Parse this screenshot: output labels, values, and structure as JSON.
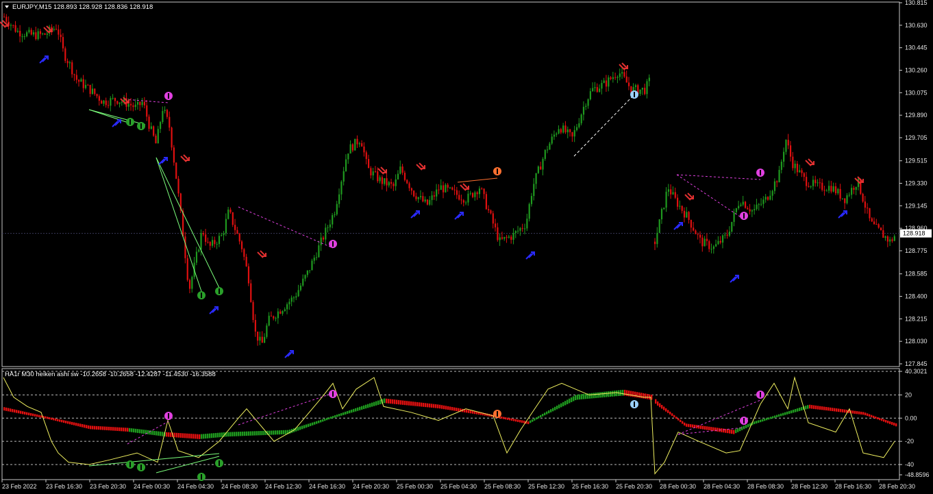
{
  "window": {
    "symbol_header": "EURJPY,M15  128.893 128.928 128.836 128.918",
    "menu_icon": "triangle-down-icon"
  },
  "price_axis": {
    "labels": [
      "130.815",
      "130.630",
      "130.445",
      "130.260",
      "130.075",
      "129.890",
      "129.705",
      "129.515",
      "129.330",
      "129.145",
      "128.960",
      "128.775",
      "128.585",
      "128.400",
      "128.215",
      "128.030",
      "127.845"
    ],
    "current_price": "128.918",
    "min": 127.845,
    "max": 130.815
  },
  "indicator": {
    "header": "HA1r M30 heiken ashi sw -10.2658 -10.2658 -12.4287 -11.4530 -16.3588",
    "axis_labels": [
      "40.3021",
      "20",
      "0.00",
      "-20",
      "-40",
      "-48.8596"
    ],
    "levels": [
      20,
      0,
      -20,
      -40
    ]
  },
  "time_axis": {
    "labels": [
      "23 Feb 2022",
      "23 Feb 16:30",
      "23 Feb 20:30",
      "24 Feb 00:30",
      "24 Feb 04:30",
      "24 Feb 08:30",
      "24 Feb 12:30",
      "24 Feb 16:30",
      "24 Feb 20:30",
      "25 Feb 00:30",
      "25 Feb 04:30",
      "25 Feb 08:30",
      "25 Feb 12:30",
      "25 Feb 16:30",
      "25 Feb 20:30",
      "28 Feb 00:30",
      "28 Feb 04:30",
      "28 Feb 08:30",
      "28 Feb 12:30",
      "28 Feb 16:30",
      "28 Feb 20:30"
    ]
  },
  "colors": {
    "background": "#000000",
    "bull": "#1f9a1f",
    "bear": "#e01010",
    "grid": "#1a1a3a",
    "axis": "#cfcfcf",
    "divergence": "#e040e0",
    "signal_up": "#2a2aff",
    "signal_down": "#e03030",
    "osc_line": "#f0f060"
  },
  "chart_data": {
    "type": "candlestick",
    "close_path": [
      [
        0,
        130.7
      ],
      [
        2,
        130.58
      ],
      [
        4,
        130.55
      ],
      [
        6,
        130.55
      ],
      [
        8,
        130.62
      ],
      [
        9,
        130.4
      ],
      [
        10,
        130.3
      ],
      [
        11,
        130.18
      ],
      [
        13,
        130.1
      ],
      [
        15,
        130.0
      ],
      [
        17,
        130.02
      ],
      [
        19,
        129.98
      ],
      [
        20,
        129.95
      ],
      [
        21,
        130.0
      ],
      [
        22,
        129.8
      ],
      [
        23,
        129.65
      ],
      [
        24,
        129.95
      ],
      [
        25,
        129.8
      ],
      [
        26,
        129.4
      ],
      [
        27,
        128.95
      ],
      [
        28,
        128.45
      ],
      [
        29,
        128.7
      ],
      [
        30,
        128.95
      ],
      [
        31,
        128.8
      ],
      [
        33,
        128.9
      ],
      [
        34,
        129.1
      ],
      [
        35,
        128.95
      ],
      [
        36,
        128.8
      ],
      [
        37,
        128.55
      ],
      [
        38,
        128.1
      ],
      [
        39,
        128.0
      ],
      [
        40,
        128.2
      ],
      [
        42,
        128.3
      ],
      [
        44,
        128.4
      ],
      [
        46,
        128.6
      ],
      [
        48,
        128.85
      ],
      [
        50,
        129.1
      ],
      [
        52,
        129.6
      ],
      [
        54,
        129.7
      ],
      [
        55,
        129.45
      ],
      [
        57,
        129.35
      ],
      [
        59,
        129.3
      ],
      [
        60,
        129.45
      ],
      [
        62,
        129.25
      ],
      [
        64,
        129.15
      ],
      [
        66,
        129.3
      ],
      [
        68,
        129.25
      ],
      [
        70,
        129.2
      ],
      [
        72,
        129.3
      ],
      [
        74,
        129.0
      ],
      [
        75,
        128.85
      ],
      [
        77,
        128.9
      ],
      [
        79,
        129.0
      ],
      [
        80,
        129.3
      ],
      [
        82,
        129.6
      ],
      [
        84,
        129.8
      ],
      [
        86,
        129.7
      ],
      [
        88,
        130.0
      ],
      [
        89,
        130.1
      ],
      [
        91,
        130.15
      ],
      [
        93,
        130.25
      ],
      [
        95,
        130.1
      ],
      [
        97,
        130.1
      ],
      [
        98,
        130.2
      ]
    ],
    "close_path_2": [
      [
        0,
        128.85
      ],
      [
        2,
        129.3
      ],
      [
        3,
        129.2
      ],
      [
        5,
        129.05
      ],
      [
        7,
        128.85
      ],
      [
        9,
        128.8
      ],
      [
        11,
        128.9
      ],
      [
        13,
        129.2
      ],
      [
        15,
        129.1
      ],
      [
        17,
        129.2
      ],
      [
        19,
        129.4
      ],
      [
        20,
        129.7
      ],
      [
        21,
        129.5
      ],
      [
        23,
        129.35
      ],
      [
        25,
        129.3
      ],
      [
        27,
        129.3
      ],
      [
        29,
        129.2
      ],
      [
        31,
        129.35
      ],
      [
        33,
        129.0
      ],
      [
        35,
        128.9
      ],
      [
        36,
        128.85
      ],
      [
        37,
        128.92
      ]
    ],
    "oscillator_range": [
      -48.8596,
      40.3021
    ]
  }
}
